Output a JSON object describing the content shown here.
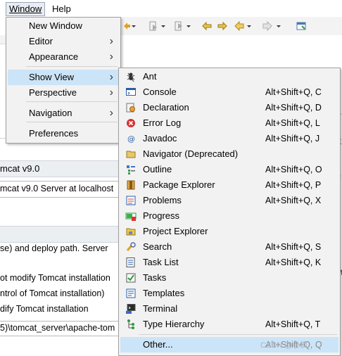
{
  "menubar": {
    "window": "Window",
    "help": "Help"
  },
  "background": {
    "header1": "mcat v9.0",
    "server_field": "mcat v9.0 Server at localhost",
    "deploy_text": "se) and deploy path. Server",
    "opt1": "ot modify Tomcat installation",
    "opt2": "ntrol of Tomcat installation)",
    "opt3": "dify Tomcat installation",
    "path": "5)\\tomcat_server\\apache-tom"
  },
  "window_menu": {
    "items": [
      {
        "label": "New Window"
      },
      {
        "label": "Editor"
      },
      {
        "label": "Appearance"
      },
      {
        "label": "Show View"
      },
      {
        "label": "Perspective"
      },
      {
        "label": "Navigation"
      },
      {
        "label": "Preferences"
      }
    ],
    "highlighted": "Show View"
  },
  "show_view_menu": {
    "items": [
      {
        "label": "Ant",
        "shortcut": "",
        "icon": "ant-icon"
      },
      {
        "label": "Console",
        "shortcut": "Alt+Shift+Q, C",
        "icon": "console-icon"
      },
      {
        "label": "Declaration",
        "shortcut": "Alt+Shift+Q, D",
        "icon": "declaration-icon"
      },
      {
        "label": "Error Log",
        "shortcut": "Alt+Shift+Q, L",
        "icon": "error-log-icon"
      },
      {
        "label": "Javadoc",
        "shortcut": "Alt+Shift+Q, J",
        "icon": "javadoc-icon"
      },
      {
        "label": "Navigator (Deprecated)",
        "shortcut": "",
        "icon": "navigator-icon"
      },
      {
        "label": "Outline",
        "shortcut": "Alt+Shift+Q, O",
        "icon": "outline-icon"
      },
      {
        "label": "Package Explorer",
        "shortcut": "Alt+Shift+Q, P",
        "icon": "package-explorer-icon"
      },
      {
        "label": "Problems",
        "shortcut": "Alt+Shift+Q, X",
        "icon": "problems-icon"
      },
      {
        "label": "Progress",
        "shortcut": "",
        "icon": "progress-icon"
      },
      {
        "label": "Project Explorer",
        "shortcut": "",
        "icon": "project-explorer-icon"
      },
      {
        "label": "Search",
        "shortcut": "Alt+Shift+Q, S",
        "icon": "search-icon"
      },
      {
        "label": "Task List",
        "shortcut": "Alt+Shift+Q, K",
        "icon": "task-list-icon"
      },
      {
        "label": "Tasks",
        "shortcut": "",
        "icon": "tasks-icon"
      },
      {
        "label": "Templates",
        "shortcut": "",
        "icon": "templates-icon"
      },
      {
        "label": "Terminal",
        "shortcut": "",
        "icon": "terminal-icon"
      },
      {
        "label": "Type Hierarchy",
        "shortcut": "Alt+Shift+Q, T",
        "icon": "type-hierarchy-icon"
      },
      {
        "label": "Other...",
        "shortcut": "Alt+Shift+Q, Q",
        "icon": ""
      }
    ],
    "highlighted": "Other..."
  },
  "watermark": "CSDN @小枫"
}
